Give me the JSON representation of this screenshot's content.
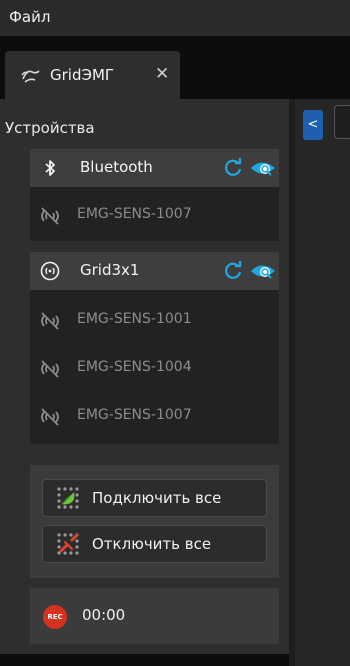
{
  "menu": {
    "file": "Файл"
  },
  "tab": {
    "title": "GridЭМГ",
    "icon": "wave-hand-icon",
    "close": "✕"
  },
  "right_panel": {
    "collapse_label": "<"
  },
  "sidebar": {
    "title": "Устройства",
    "groups": [
      {
        "name": "Bluetooth",
        "icon": "bluetooth-icon",
        "devices": [
          {
            "label": "EMG-SENS-1007",
            "status": "disconnected"
          }
        ]
      },
      {
        "name": "Grid3x1",
        "icon": "grid-signal-icon",
        "devices": [
          {
            "label": "EMG-SENS-1001",
            "status": "disconnected"
          },
          {
            "label": "EMG-SENS-1004",
            "status": "disconnected"
          },
          {
            "label": "EMG-SENS-1007",
            "status": "disconnected"
          }
        ]
      }
    ],
    "actions": {
      "connect_all": "Подключить все",
      "disconnect_all": "Отключить все"
    },
    "recording": {
      "badge": "REC",
      "time": "00:00"
    }
  },
  "colors": {
    "accent_blue": "#1ea7e0",
    "collapse_blue": "#1e5fae",
    "rec_red": "#d6311f",
    "connect_green": "#6ec23c",
    "disconnect_red": "#e0432b"
  }
}
